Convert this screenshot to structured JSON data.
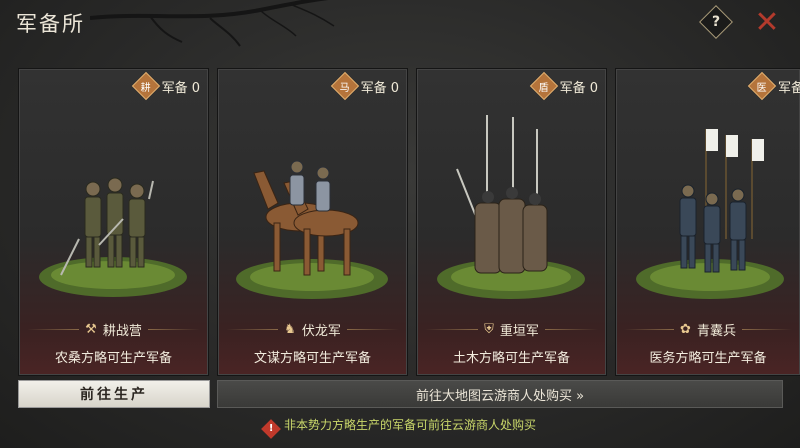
{
  "header": {
    "title": "军备所",
    "help_label": "?",
    "close_label": "✕"
  },
  "cards": [
    {
      "badge_label": "军备 0",
      "badge_icon": "耕",
      "unit_name": "耕战营",
      "unit_icon": "farmer-icon",
      "description": "农桑方略可生产军备",
      "scene": "infantry-group"
    },
    {
      "badge_label": "军备 0",
      "badge_icon": "马",
      "unit_name": "伏龙军",
      "unit_icon": "horse-icon",
      "description": "文谋方略可生产军备",
      "scene": "cavalry"
    },
    {
      "badge_label": "军备 0",
      "badge_icon": "盾",
      "unit_name": "重垣军",
      "unit_icon": "shield-icon",
      "description": "土木方略可生产军备",
      "scene": "shield-wall"
    },
    {
      "badge_label": "军备",
      "badge_icon": "医",
      "unit_name": "青囊兵",
      "unit_icon": "medic-icon",
      "description": "医务方略可生产军备",
      "scene": "banner-troops"
    }
  ],
  "footer": {
    "produce_button": "前往生产",
    "merchant_button": "前往大地图云游商人处购买 »",
    "notice": "非本势力方略生产的军备可前往云游商人处购买",
    "notice_icon": "!"
  },
  "colors": {
    "close": "#b33a2c",
    "notice_text": "#c9d76a",
    "accent_badge": "#b5743b"
  }
}
